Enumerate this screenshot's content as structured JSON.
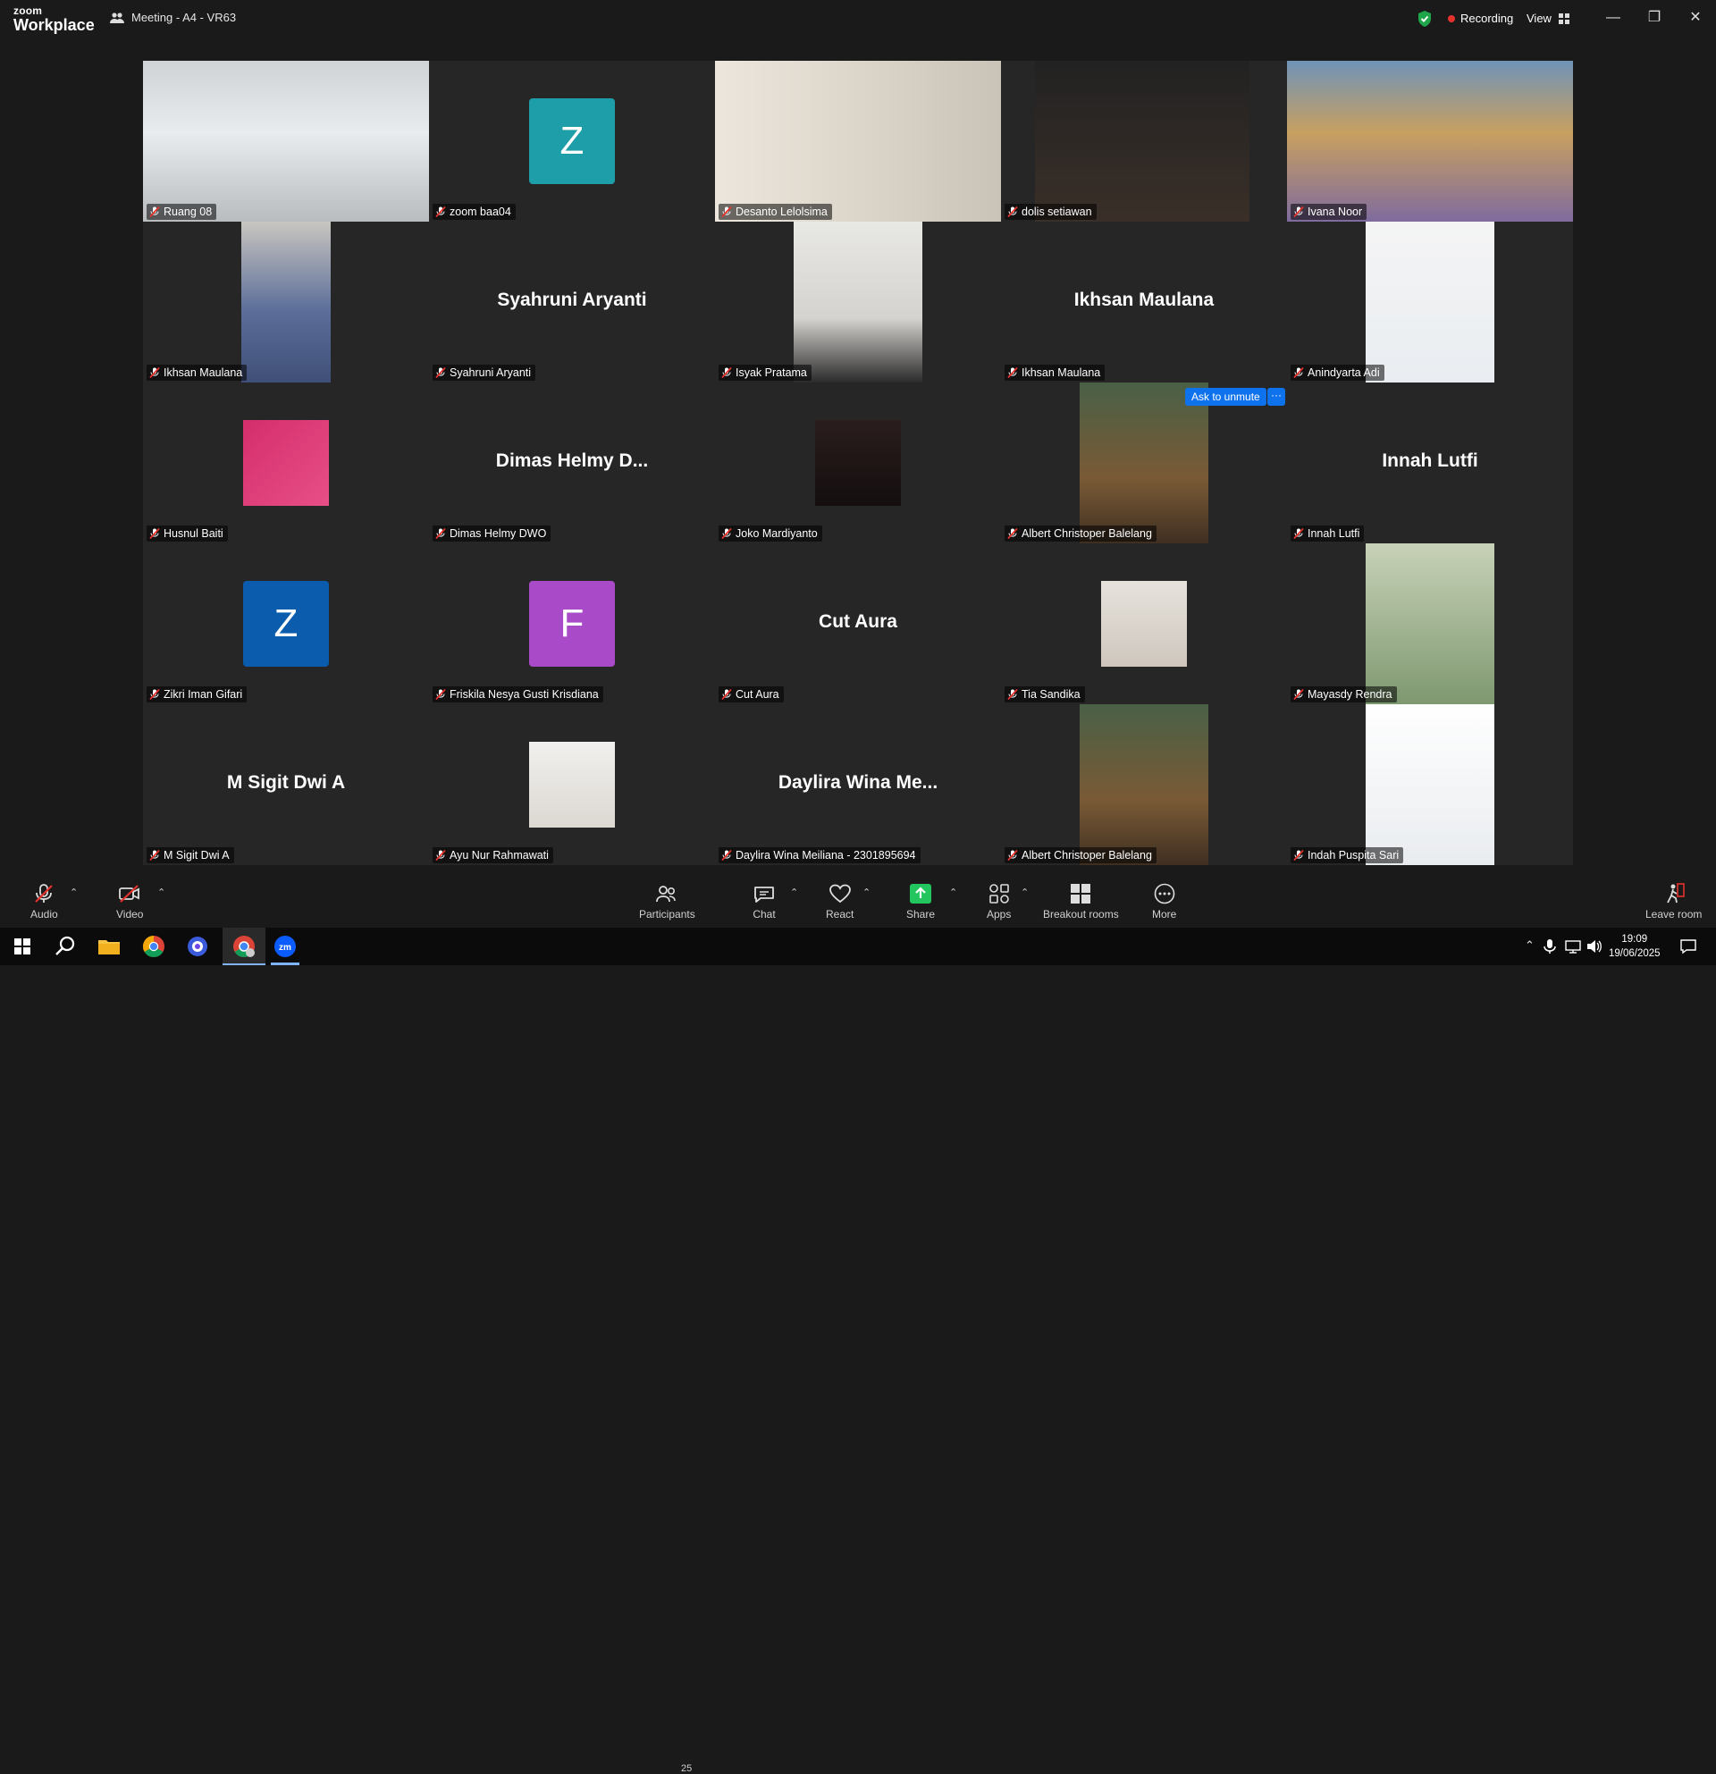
{
  "app": {
    "brand_top": "zoom",
    "brand_bottom": "Workplace",
    "meeting_title": "Meeting - A4 - VR63"
  },
  "header": {
    "recording_label": "Recording",
    "view_label": "View"
  },
  "gallery": {
    "tiles": [
      {
        "name": "Ruang 08",
        "display": "video"
      },
      {
        "name": "zoom baa04",
        "display": "avatar",
        "initial": "Z",
        "color": "#1e9ea8"
      },
      {
        "name": "Desanto Lelolsima",
        "display": "video"
      },
      {
        "name": "dolis setiawan",
        "display": "video"
      },
      {
        "name": "Ivana Noor",
        "display": "video"
      },
      {
        "name": "Ikhsan Maulana",
        "display": "video"
      },
      {
        "name": "Syahruni Aryanti",
        "display": "name",
        "big": "Syahruni Aryanti"
      },
      {
        "name": "Isyak Pratama",
        "display": "video"
      },
      {
        "name": "Ikhsan Maulana",
        "display": "name",
        "big": "Ikhsan Maulana"
      },
      {
        "name": "Anindyarta Adi",
        "display": "video"
      },
      {
        "name": "Husnul Baiti",
        "display": "video"
      },
      {
        "name": "Dimas Helmy DWO",
        "display": "name",
        "big": "Dimas Helmy D..."
      },
      {
        "name": "Joko Mardiyanto",
        "display": "video"
      },
      {
        "name": "Albert Christoper Balelang",
        "display": "video"
      },
      {
        "name": "Innah Lutfi",
        "display": "name",
        "big": "Innah Lutfi"
      },
      {
        "name": "Zikri Iman Gifari",
        "display": "avatar",
        "initial": "Z",
        "color": "#0b5cad"
      },
      {
        "name": "Friskila Nesya Gusti Krisdiana",
        "display": "avatar",
        "initial": "F",
        "color": "#a94bc9"
      },
      {
        "name": "Cut Aura",
        "display": "name",
        "big": "Cut Aura"
      },
      {
        "name": "Tia Sandika",
        "display": "video"
      },
      {
        "name": "Mayasdy Rendra",
        "display": "video"
      },
      {
        "name": "M Sigit Dwi A",
        "display": "name",
        "big": "M Sigit Dwi A"
      },
      {
        "name": "Ayu Nur Rahmawati",
        "display": "video"
      },
      {
        "name": "Daylira Wina Meiliana - 2301895694",
        "display": "name",
        "big": "Daylira Wina Me..."
      },
      {
        "name": "Albert Christoper Balelang",
        "display": "video"
      },
      {
        "name": "Indah Puspita Sari",
        "display": "video"
      }
    ],
    "ask_unmute": "Ask to unmute",
    "ask_more": "···"
  },
  "toolbar": {
    "audio": "Audio",
    "video": "Video",
    "participants": "Participants",
    "participants_count": "25",
    "chat": "Chat",
    "react": "React",
    "share": "Share",
    "apps": "Apps",
    "breakout": "Breakout rooms",
    "more": "More",
    "leave": "Leave room"
  },
  "taskbar": {
    "time": "19:09",
    "date": "19/06/2025"
  },
  "colors": {
    "active_speaker": "#2ddc82",
    "recording": "#e5322d",
    "share": "#22c55e",
    "ask_button": "#0e72ed"
  }
}
